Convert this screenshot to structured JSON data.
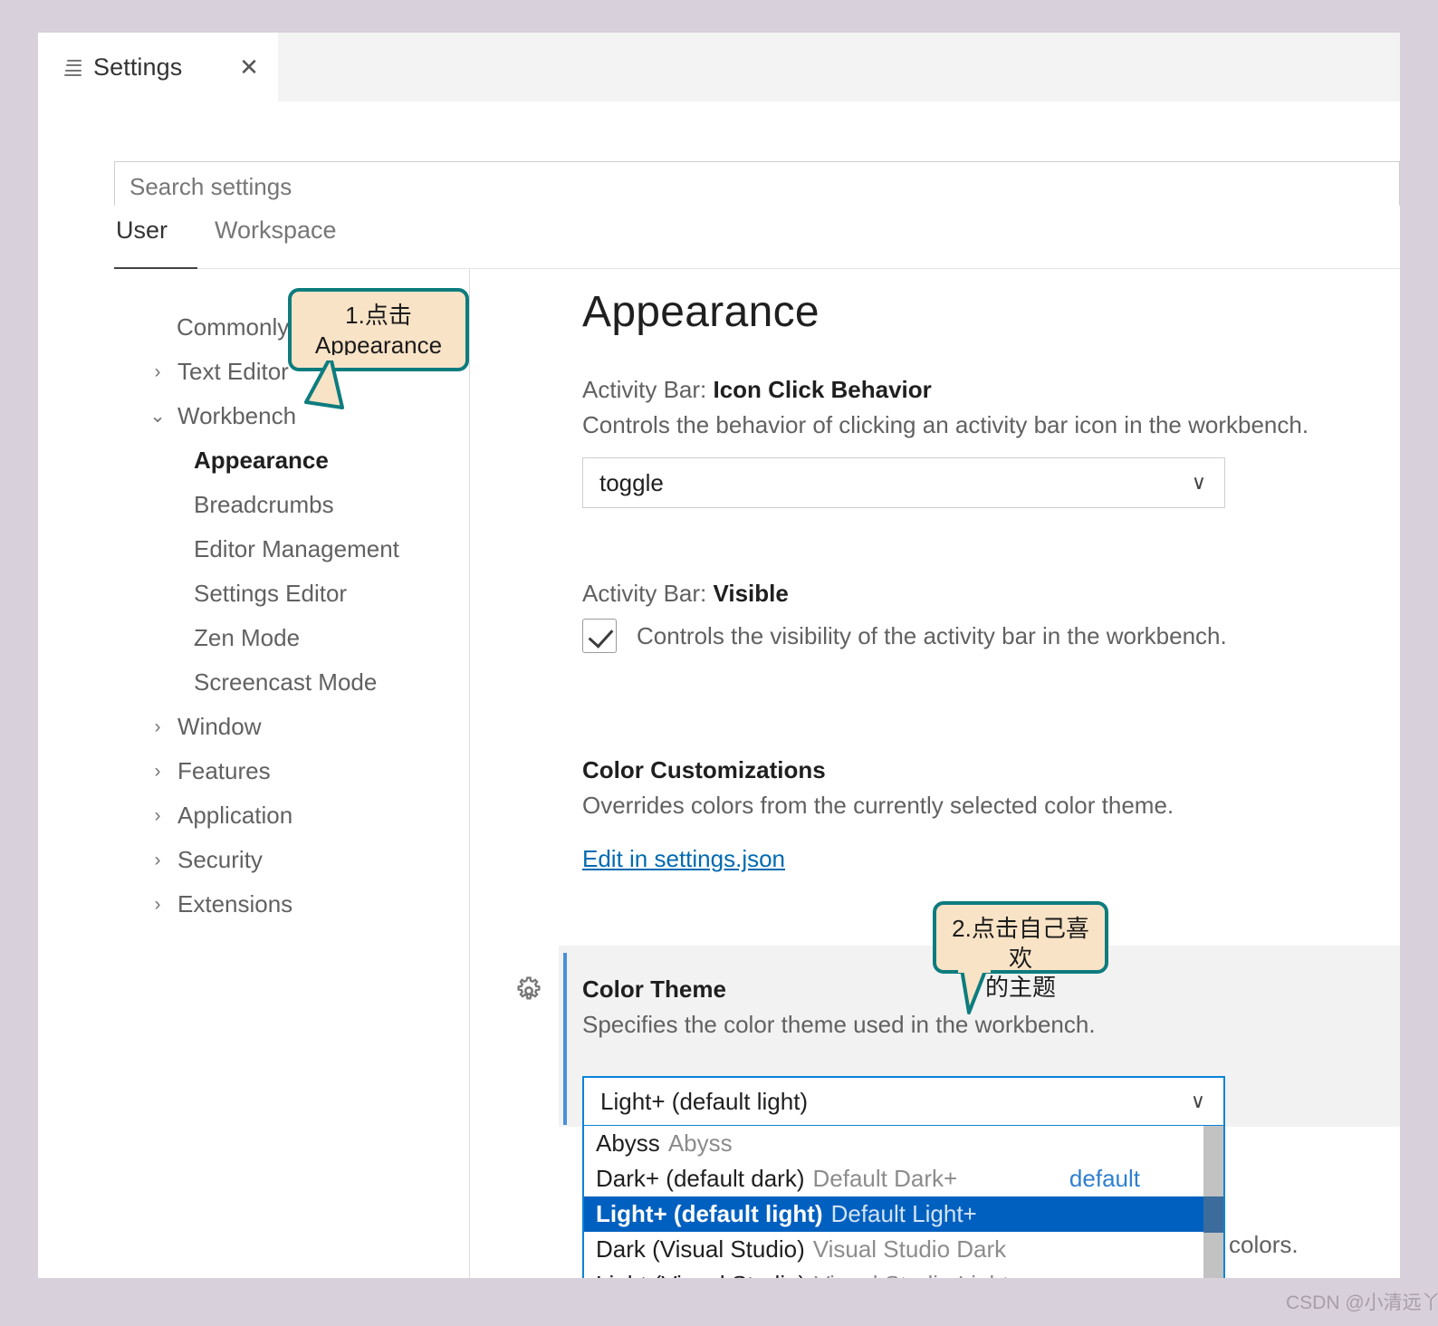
{
  "window": {
    "tab": {
      "label": "Settings",
      "icon": "settings-list-icon",
      "close": "✕"
    }
  },
  "search": {
    "placeholder": "Search settings",
    "value": ""
  },
  "scope_tabs": [
    {
      "label": "User",
      "active": true
    },
    {
      "label": "Workspace",
      "active": false
    }
  ],
  "toc": {
    "items": [
      {
        "label": "Commonly Used",
        "level": 0,
        "chevron": "",
        "active": false
      },
      {
        "label": "Text Editor",
        "level": 1,
        "chevron": "›",
        "active": false
      },
      {
        "label": "Workbench",
        "level": 1,
        "chevron": "⌄",
        "active": false
      },
      {
        "label": "Appearance",
        "level": 2,
        "chevron": "",
        "active": true
      },
      {
        "label": "Breadcrumbs",
        "level": 2,
        "chevron": "",
        "active": false
      },
      {
        "label": "Editor Management",
        "level": 2,
        "chevron": "",
        "active": false
      },
      {
        "label": "Settings Editor",
        "level": 2,
        "chevron": "",
        "active": false
      },
      {
        "label": "Zen Mode",
        "level": 2,
        "chevron": "",
        "active": false
      },
      {
        "label": "Screencast Mode",
        "level": 2,
        "chevron": "",
        "active": false
      },
      {
        "label": "Window",
        "level": 1,
        "chevron": "›",
        "active": false
      },
      {
        "label": "Features",
        "level": 1,
        "chevron": "›",
        "active": false
      },
      {
        "label": "Application",
        "level": 1,
        "chevron": "›",
        "active": false
      },
      {
        "label": "Security",
        "level": 1,
        "chevron": "›",
        "active": false
      },
      {
        "label": "Extensions",
        "level": 1,
        "chevron": "›",
        "active": false
      }
    ]
  },
  "main": {
    "page_title": "Appearance",
    "settings": {
      "icon_click_behavior": {
        "prefix": "Activity Bar: ",
        "name": "Icon Click Behavior",
        "description": "Controls the behavior of clicking an activity bar icon in the workbench.",
        "value": "toggle",
        "chevron": "∨"
      },
      "activity_bar_visible": {
        "prefix": "Activity Bar: ",
        "name": "Visible",
        "description": "Controls the visibility of the activity bar in the workbench.",
        "checked": true
      },
      "color_customizations": {
        "name": "Color Customizations",
        "description": "Overrides colors from the currently selected color theme.",
        "link": "Edit in settings.json"
      },
      "color_theme": {
        "name": "Color Theme",
        "description": "Specifies the color theme used in the workbench.",
        "value": "Light+ (default light)",
        "chevron": "∨",
        "gear_icon": "gear-icon",
        "options": [
          {
            "name": "Abyss",
            "sub": "Abyss",
            "badge": "",
            "selected": false
          },
          {
            "name": "Dark+ (default dark)",
            "sub": "Default Dark+",
            "badge": "default",
            "selected": false
          },
          {
            "name": "Light+ (default light)",
            "sub": "Default Light+",
            "badge": "",
            "selected": true
          },
          {
            "name": "Dark (Visual Studio)",
            "sub": "Visual Studio Dark",
            "badge": "",
            "selected": false
          },
          {
            "name": "Light (Visual Studio)",
            "sub": "Visual Studio Light",
            "badge": "",
            "selected": false
          }
        ]
      }
    },
    "occluded_text": "colors."
  },
  "callouts": [
    {
      "line1": "1.点击",
      "line2": "Appearance"
    },
    {
      "line1": "2.点击自己喜欢",
      "line2": "的主题"
    }
  ],
  "watermark": "CSDN @小清远丫",
  "colors": {
    "page_background": "#d8d0da",
    "window_background": "#ffffff",
    "tabbar_inactive": "#f3f3f3",
    "accent_blue": "#0a84d8",
    "selection_blue": "#0060c0",
    "link_blue": "#006ab1",
    "callout_fill": "#f9e3c6",
    "callout_border": "#0d7c7e",
    "row_highlight": "#f2f2f2"
  }
}
